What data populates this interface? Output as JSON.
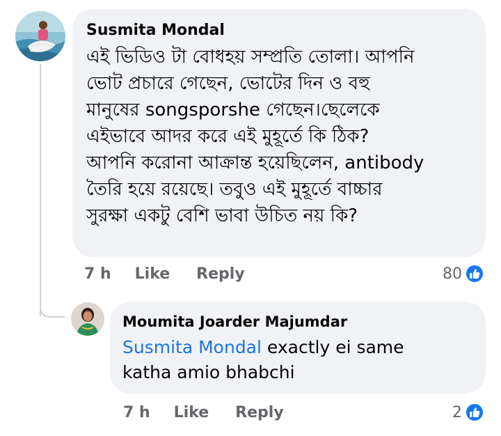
{
  "comments": [
    {
      "author": "Susmita Mondal",
      "avatar_icon": "profile-photo-icon",
      "text_lines": [
        "এই ভিডিও টা বোধহয় সম্প্রতি তোলা। আপনি",
        "ভোট প্রচারে গেছেন,  ভোটের দিন ও বহু",
        "মানুষের songsporshe গেছেন।ছেলেকে",
        "এইভাবে আদর করে এই মুহূর্তে কি ঠিক?",
        "আপনি করোনা আক্রান্ত হয়েছিলেন, antibody",
        "তৈরি হয়ে রয়েছে। তবুও এই মুহূর্তে বাচ্চার",
        "সুরক্ষা একটু বেশি ভাবা উচিত নয় কি?"
      ],
      "time": "7 h",
      "like_label": "Like",
      "reply_label": "Reply",
      "reaction_count": "80",
      "reaction_icon": "like-reaction-icon"
    },
    {
      "author": "Moumita Joarder Majumdar",
      "avatar_icon": "profile-photo-icon",
      "mention": "Susmita Mondal",
      "text_after_mention": " exactly ei same",
      "text_line_2": "katha amio bhabchi",
      "time": "7 h",
      "like_label": "Like",
      "reply_label": "Reply",
      "reaction_count": "2",
      "reaction_icon": "like-reaction-icon"
    }
  ],
  "colors": {
    "bubble": "#f0f2f5",
    "mention": "#1b74e4",
    "meta": "#65676b",
    "like_blue": "#1877f2"
  }
}
